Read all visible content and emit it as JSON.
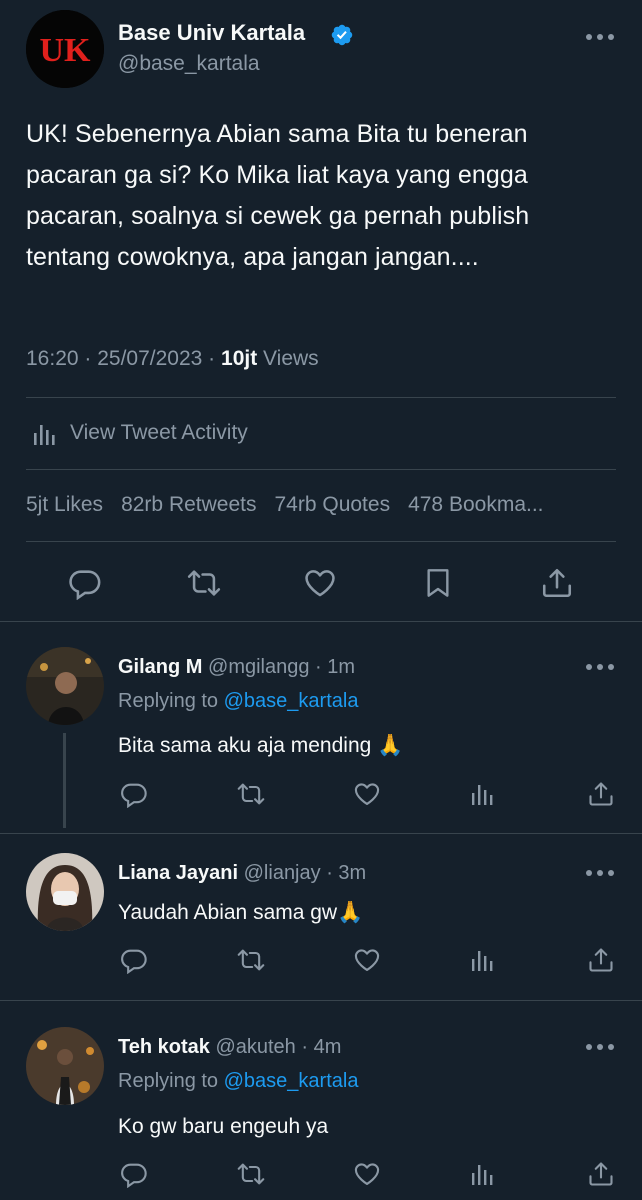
{
  "main_tweet": {
    "avatar_text": "UK",
    "name": "Base Univ Kartala",
    "handle": "@base_kartala",
    "verified_icon": "verified-badge-icon",
    "body": "UK! Sebenernya Abian sama Bita tu beneran pacaran ga si? Ko Mika liat kaya yang engga pacaran, soalnya si cewek ga pernah publish tentang cowoknya, apa jangan jangan....",
    "time": "16:20",
    "date": "25/07/2023",
    "views_count": "10jt",
    "views_label": "Views",
    "activity_label": "View Tweet Activity",
    "stats": [
      {
        "value": "5jt",
        "label": "Likes"
      },
      {
        "value": "82rb",
        "label": "Retweets"
      },
      {
        "value": "74rb",
        "label": "Quotes"
      },
      {
        "value": "478",
        "label": "Bookma..."
      }
    ]
  },
  "replies": [
    {
      "name": "Gilang M",
      "handle": "@mgilangg",
      "time": "1m",
      "replying_prefix": "Replying to",
      "replying_handle": "@base_kartala",
      "text": "Bita sama aku aja mending 🙏"
    },
    {
      "name": "Liana Jayani",
      "handle": "@lianjay",
      "time": "3m",
      "text": "Yaudah Abian sama gw🙏"
    },
    {
      "name": "Teh kotak",
      "handle": "@akuteh",
      "time": "4m",
      "replying_prefix": "Replying to",
      "replying_handle": "@base_kartala",
      "text": "Ko gw baru engeuh ya"
    }
  ],
  "colors": {
    "background": "#15202b",
    "text": "#f7f9f9",
    "muted": "#8b98a5",
    "accent": "#1d9bf0",
    "divider": "#38444d",
    "logo_red": "#e0201c"
  }
}
